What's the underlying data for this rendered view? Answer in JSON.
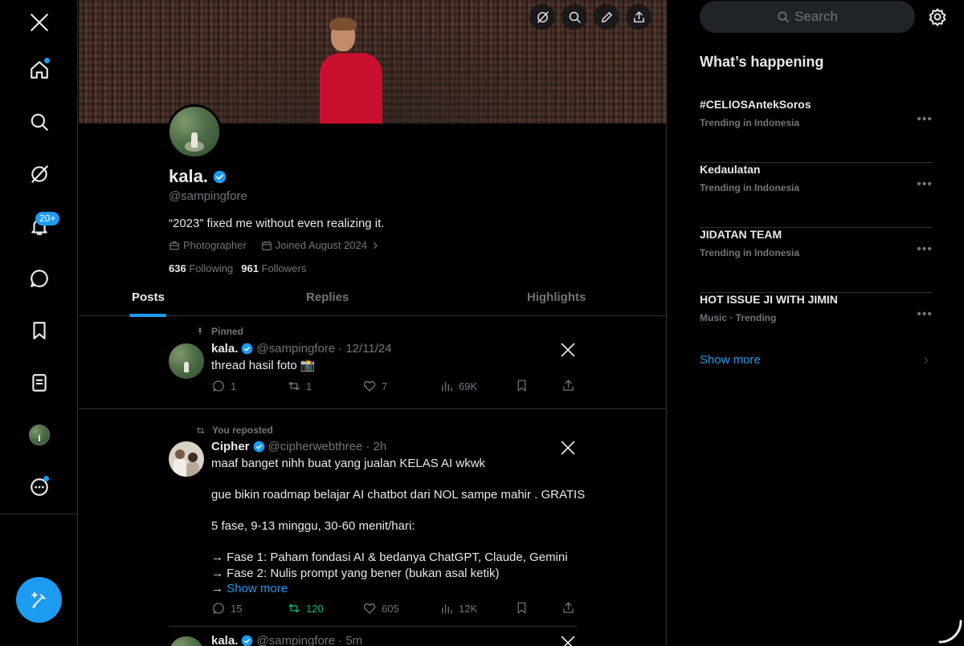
{
  "nav": {
    "items": [
      "x-logo",
      "home-icon",
      "search-icon",
      "grok-icon",
      "notifications-icon",
      "messages-icon",
      "bookmarks-icon",
      "lists-icon",
      "profile-avatar",
      "more-icon"
    ],
    "notifications_badge": "20+"
  },
  "profile": {
    "display_name": "kala.",
    "handle": "@sampingfore",
    "bio": "“2023” fixed me without even realizing it.",
    "category": "Photographer",
    "joined": "Joined August 2024",
    "following_count": "636",
    "following_label": "Following",
    "followers_count": "961",
    "followers_label": "Followers"
  },
  "tabs": [
    "Posts",
    "Replies",
    "Highlights"
  ],
  "active_tab": "Posts",
  "posts": [
    {
      "context": "Pinned",
      "name": "kala.",
      "handle": "@sampingfore",
      "time": "· 12/11/24",
      "text": "thread hasil foto 📸",
      "replies": "1",
      "reposts": "1",
      "likes": "7",
      "views": "69K"
    },
    {
      "context": "You reposted",
      "name": "Cipher",
      "handle": "@cipherwebthree",
      "time": "· 2h",
      "text": "maaf banget nihh buat yang jualan KELAS AI wkwk\n\ngue bikin roadmap belajar AI chatbot dari NOL sampe mahir . GRATIS\n\n5 fase, 9-13 minggu, 30-60 menit/hari:\n\n→ Fase 1: Paham fondasi AI & bedanya ChatGPT, Claude, Gemini\n→ Fase 2: Nulis prompt yang bener (bukan asal ketik)\n→ ",
      "show_more": "Show more",
      "replies": "15",
      "reposts": "120",
      "likes": "605",
      "views": "12K"
    },
    {
      "name": "kala.",
      "handle": "@sampingfore",
      "time": "· 5m"
    }
  ],
  "sidebar": {
    "search_placeholder": "Search",
    "title": "What’s happening",
    "trends": [
      {
        "name": "#CELIOSAntekSoros",
        "context": "Trending in Indonesia"
      },
      {
        "name": "Kedaulatan",
        "context": "Trending in Indonesia"
      },
      {
        "name": "JIDATAN TEAM",
        "context": "Trending in Indonesia"
      },
      {
        "name": "HOT ISSUE JI WITH JIMIN",
        "context": "Music · Trending"
      }
    ],
    "show_more": "Show more"
  },
  "colors": {
    "accent": "#1d9bf0",
    "repost_active": "#00ba7c",
    "background": "#000000",
    "border": "#2f3336"
  }
}
